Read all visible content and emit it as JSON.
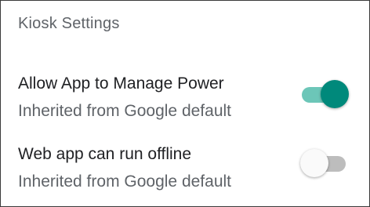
{
  "section": {
    "title": "Kiosk Settings"
  },
  "settings": [
    {
      "label": "Allow App to Manage Power",
      "subtitle": "Inherited from Google default",
      "enabled": true
    },
    {
      "label": "Web app can run offline",
      "subtitle": "Inherited from Google default",
      "enabled": false
    }
  ],
  "colors": {
    "toggle_on_thumb": "#00897b",
    "toggle_on_track": "#6cc6b8",
    "toggle_off_thumb": "#fafafa",
    "toggle_off_track": "#bdbdbd",
    "title_text": "#5f6368",
    "label_text": "#202124"
  }
}
